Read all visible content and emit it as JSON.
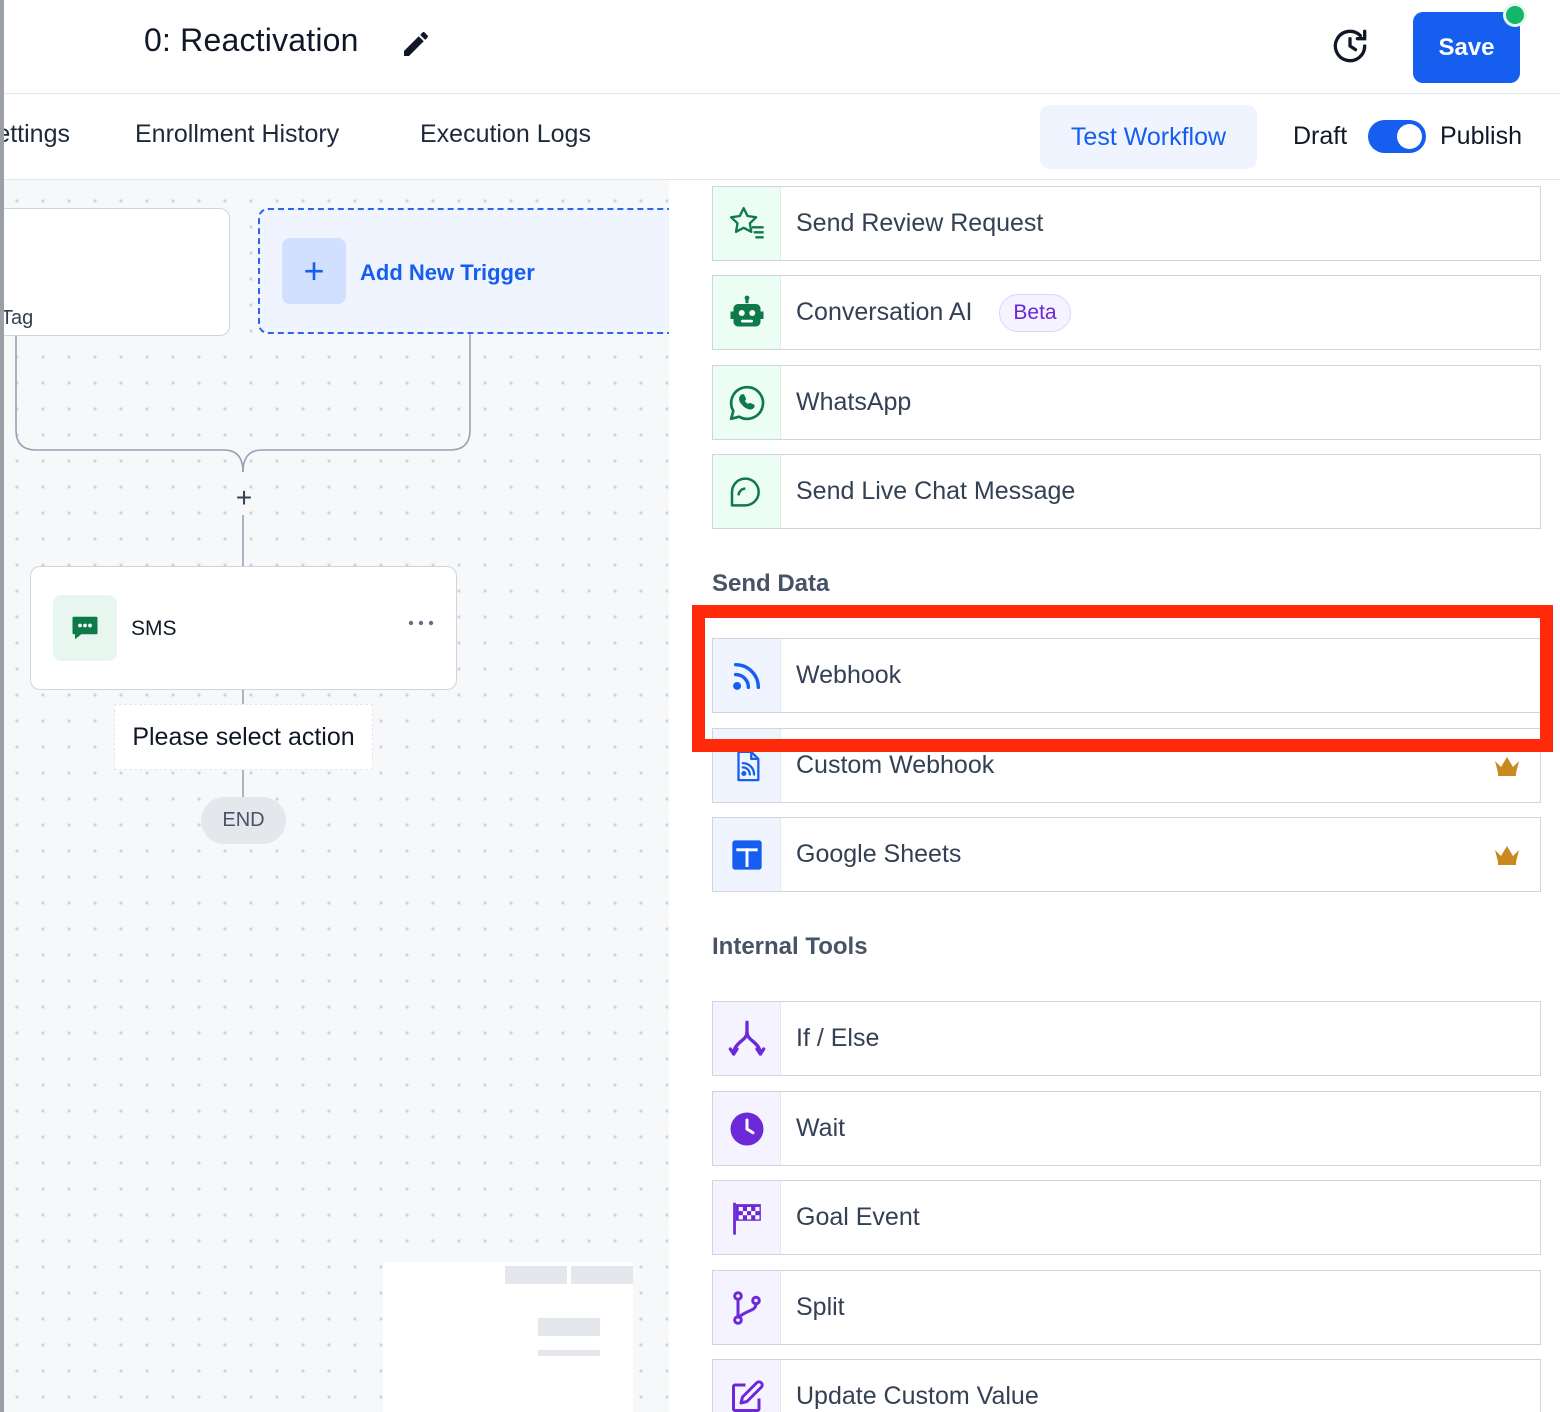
{
  "header": {
    "workflow_title": "0: Reactivation",
    "save_label": "Save"
  },
  "tabs": {
    "settings_label": "Settings",
    "enrollment_label": "Enrollment History",
    "execution_label": "Execution Logs",
    "test_workflow_label": "Test Workflow",
    "draft_label": "Draft",
    "publish_label": "Publish",
    "published": true
  },
  "canvas": {
    "trigger_card_text": "Tag",
    "add_trigger_label": "Add New Trigger",
    "sms_label": "SMS",
    "select_action_label": "Please select action",
    "end_label": "END"
  },
  "panel": {
    "communication_actions": [
      {
        "label": "Send Review Request",
        "icon": "star-list-icon"
      },
      {
        "label": "Conversation AI",
        "icon": "robot-icon",
        "badge": "Beta"
      },
      {
        "label": "WhatsApp",
        "icon": "whatsapp-icon"
      },
      {
        "label": "Send Live Chat Message",
        "icon": "chat-bubble-icon"
      }
    ],
    "send_data_title": "Send Data",
    "send_data_actions": [
      {
        "label": "Webhook",
        "icon": "webhook-icon"
      },
      {
        "label": "Custom Webhook",
        "icon": "custom-webhook-icon",
        "premium": true
      },
      {
        "label": "Google Sheets",
        "icon": "google-sheets-icon",
        "premium": true
      }
    ],
    "internal_tools_title": "Internal Tools",
    "internal_tools_actions": [
      {
        "label": "If / Else",
        "icon": "branch-icon"
      },
      {
        "label": "Wait",
        "icon": "clock-icon"
      },
      {
        "label": "Goal Event",
        "icon": "checkered-flag-icon"
      },
      {
        "label": "Split",
        "icon": "split-icon"
      },
      {
        "label": "Update Custom Value",
        "icon": "edit-square-icon"
      }
    ]
  },
  "colors": {
    "primary": "#155eef",
    "communication_icon": "#0e7a4a",
    "internal_icon": "#6d28d9",
    "highlight": "#ff2a0a",
    "crown": "#c88a1f"
  }
}
